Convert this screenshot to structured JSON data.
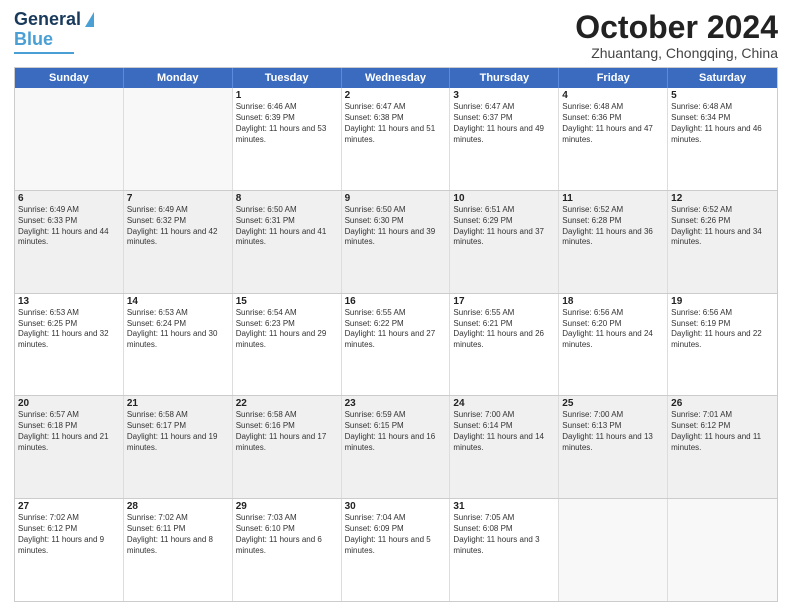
{
  "logo": {
    "line1": "General",
    "line2": "Blue"
  },
  "title": "October 2024",
  "location": "Zhuantang, Chongqing, China",
  "header_days": [
    "Sunday",
    "Monday",
    "Tuesday",
    "Wednesday",
    "Thursday",
    "Friday",
    "Saturday"
  ],
  "weeks": [
    [
      {
        "day": "",
        "empty": true
      },
      {
        "day": "",
        "empty": true
      },
      {
        "day": "1",
        "sunrise": "Sunrise: 6:46 AM",
        "sunset": "Sunset: 6:39 PM",
        "daylight": "Daylight: 11 hours and 53 minutes."
      },
      {
        "day": "2",
        "sunrise": "Sunrise: 6:47 AM",
        "sunset": "Sunset: 6:38 PM",
        "daylight": "Daylight: 11 hours and 51 minutes."
      },
      {
        "day": "3",
        "sunrise": "Sunrise: 6:47 AM",
        "sunset": "Sunset: 6:37 PM",
        "daylight": "Daylight: 11 hours and 49 minutes."
      },
      {
        "day": "4",
        "sunrise": "Sunrise: 6:48 AM",
        "sunset": "Sunset: 6:36 PM",
        "daylight": "Daylight: 11 hours and 47 minutes."
      },
      {
        "day": "5",
        "sunrise": "Sunrise: 6:48 AM",
        "sunset": "Sunset: 6:34 PM",
        "daylight": "Daylight: 11 hours and 46 minutes."
      }
    ],
    [
      {
        "day": "6",
        "sunrise": "Sunrise: 6:49 AM",
        "sunset": "Sunset: 6:33 PM",
        "daylight": "Daylight: 11 hours and 44 minutes."
      },
      {
        "day": "7",
        "sunrise": "Sunrise: 6:49 AM",
        "sunset": "Sunset: 6:32 PM",
        "daylight": "Daylight: 11 hours and 42 minutes."
      },
      {
        "day": "8",
        "sunrise": "Sunrise: 6:50 AM",
        "sunset": "Sunset: 6:31 PM",
        "daylight": "Daylight: 11 hours and 41 minutes."
      },
      {
        "day": "9",
        "sunrise": "Sunrise: 6:50 AM",
        "sunset": "Sunset: 6:30 PM",
        "daylight": "Daylight: 11 hours and 39 minutes."
      },
      {
        "day": "10",
        "sunrise": "Sunrise: 6:51 AM",
        "sunset": "Sunset: 6:29 PM",
        "daylight": "Daylight: 11 hours and 37 minutes."
      },
      {
        "day": "11",
        "sunrise": "Sunrise: 6:52 AM",
        "sunset": "Sunset: 6:28 PM",
        "daylight": "Daylight: 11 hours and 36 minutes."
      },
      {
        "day": "12",
        "sunrise": "Sunrise: 6:52 AM",
        "sunset": "Sunset: 6:26 PM",
        "daylight": "Daylight: 11 hours and 34 minutes."
      }
    ],
    [
      {
        "day": "13",
        "sunrise": "Sunrise: 6:53 AM",
        "sunset": "Sunset: 6:25 PM",
        "daylight": "Daylight: 11 hours and 32 minutes."
      },
      {
        "day": "14",
        "sunrise": "Sunrise: 6:53 AM",
        "sunset": "Sunset: 6:24 PM",
        "daylight": "Daylight: 11 hours and 30 minutes."
      },
      {
        "day": "15",
        "sunrise": "Sunrise: 6:54 AM",
        "sunset": "Sunset: 6:23 PM",
        "daylight": "Daylight: 11 hours and 29 minutes."
      },
      {
        "day": "16",
        "sunrise": "Sunrise: 6:55 AM",
        "sunset": "Sunset: 6:22 PM",
        "daylight": "Daylight: 11 hours and 27 minutes."
      },
      {
        "day": "17",
        "sunrise": "Sunrise: 6:55 AM",
        "sunset": "Sunset: 6:21 PM",
        "daylight": "Daylight: 11 hours and 26 minutes."
      },
      {
        "day": "18",
        "sunrise": "Sunrise: 6:56 AM",
        "sunset": "Sunset: 6:20 PM",
        "daylight": "Daylight: 11 hours and 24 minutes."
      },
      {
        "day": "19",
        "sunrise": "Sunrise: 6:56 AM",
        "sunset": "Sunset: 6:19 PM",
        "daylight": "Daylight: 11 hours and 22 minutes."
      }
    ],
    [
      {
        "day": "20",
        "sunrise": "Sunrise: 6:57 AM",
        "sunset": "Sunset: 6:18 PM",
        "daylight": "Daylight: 11 hours and 21 minutes."
      },
      {
        "day": "21",
        "sunrise": "Sunrise: 6:58 AM",
        "sunset": "Sunset: 6:17 PM",
        "daylight": "Daylight: 11 hours and 19 minutes."
      },
      {
        "day": "22",
        "sunrise": "Sunrise: 6:58 AM",
        "sunset": "Sunset: 6:16 PM",
        "daylight": "Daylight: 11 hours and 17 minutes."
      },
      {
        "day": "23",
        "sunrise": "Sunrise: 6:59 AM",
        "sunset": "Sunset: 6:15 PM",
        "daylight": "Daylight: 11 hours and 16 minutes."
      },
      {
        "day": "24",
        "sunrise": "Sunrise: 7:00 AM",
        "sunset": "Sunset: 6:14 PM",
        "daylight": "Daylight: 11 hours and 14 minutes."
      },
      {
        "day": "25",
        "sunrise": "Sunrise: 7:00 AM",
        "sunset": "Sunset: 6:13 PM",
        "daylight": "Daylight: 11 hours and 13 minutes."
      },
      {
        "day": "26",
        "sunrise": "Sunrise: 7:01 AM",
        "sunset": "Sunset: 6:12 PM",
        "daylight": "Daylight: 11 hours and 11 minutes."
      }
    ],
    [
      {
        "day": "27",
        "sunrise": "Sunrise: 7:02 AM",
        "sunset": "Sunset: 6:12 PM",
        "daylight": "Daylight: 11 hours and 9 minutes."
      },
      {
        "day": "28",
        "sunrise": "Sunrise: 7:02 AM",
        "sunset": "Sunset: 6:11 PM",
        "daylight": "Daylight: 11 hours and 8 minutes."
      },
      {
        "day": "29",
        "sunrise": "Sunrise: 7:03 AM",
        "sunset": "Sunset: 6:10 PM",
        "daylight": "Daylight: 11 hours and 6 minutes."
      },
      {
        "day": "30",
        "sunrise": "Sunrise: 7:04 AM",
        "sunset": "Sunset: 6:09 PM",
        "daylight": "Daylight: 11 hours and 5 minutes."
      },
      {
        "day": "31",
        "sunrise": "Sunrise: 7:05 AM",
        "sunset": "Sunset: 6:08 PM",
        "daylight": "Daylight: 11 hours and 3 minutes."
      },
      {
        "day": "",
        "empty": true
      },
      {
        "day": "",
        "empty": true
      }
    ]
  ]
}
